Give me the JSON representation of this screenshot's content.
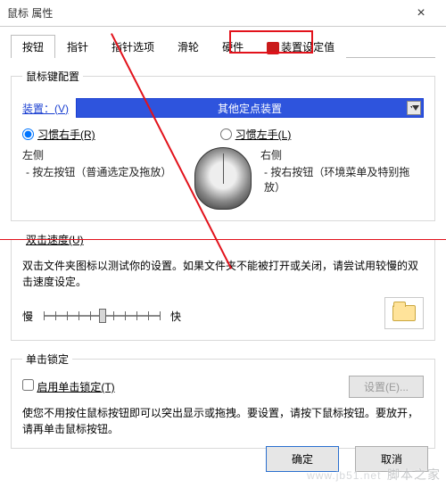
{
  "window": {
    "title": "鼠标 属性",
    "close": "×"
  },
  "tabs": {
    "items": [
      "按钮",
      "指针",
      "指针选项",
      "滑轮",
      "硬件",
      "装置设定值"
    ],
    "activeIndex": 0,
    "highlightIndex": 5
  },
  "config": {
    "groupTitle": "鼠标键配置",
    "deviceLabel": "装置：(V)",
    "deviceValue": "其他定点装置",
    "rightHanded": "习惯右手(R)",
    "leftHanded": "习惯左手(L)",
    "selectedHand": "right",
    "leftSide": {
      "title": "左侧",
      "sub": "- 按左按钮（普通选定及拖放）"
    },
    "rightSide": {
      "title": "右侧",
      "sub": "- 按右按钮（环境菜单及特别拖放）"
    }
  },
  "doubleClick": {
    "groupTitle": "双击速度(U)",
    "desc": "双击文件夹图标以测试你的设置。如果文件夹不能被打开或关闭，请尝试用较慢的双击速度设定。",
    "slow": "慢",
    "fast": "快"
  },
  "clickLock": {
    "groupTitle": "单击锁定",
    "enableLabel": "启用单击锁定(T)",
    "settingsBtn": "设置(E)...",
    "desc": "使您不用按住鼠标按钮即可以突出显示或拖拽。要设置，请按下鼠标按钮。要放开，请再单击鼠标按钮。"
  },
  "footer": {
    "ok": "确定",
    "cancel": "取消"
  },
  "watermark": {
    "url": "www.jb51.net",
    "name": "脚本之家"
  }
}
